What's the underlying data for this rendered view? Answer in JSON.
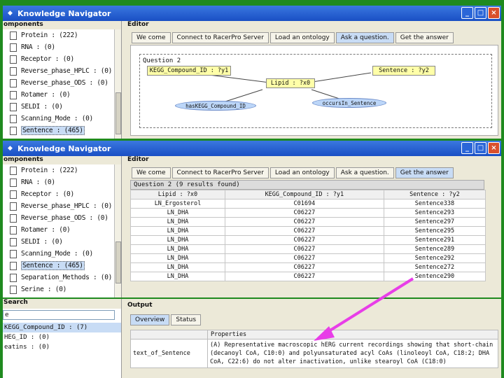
{
  "window1": {
    "title": "Knowledge Navigator",
    "components_header": "omponents",
    "editor_header": "Editor",
    "tree_items": [
      "Protein : (222)",
      "RNA : (0)",
      "Receptor : (0)",
      "Reverse_phase_HPLC : (0)",
      "Reverse_phase_ODS : (0)",
      "Rotamer : (0)",
      "SELDI : (0)",
      "Scanning_Mode : (0)",
      "Sentence : (465)"
    ],
    "selected_item": 8,
    "tabs": [
      "We come",
      "Connect to RacerPro Server",
      "Load an ontology",
      "Ask a question.",
      "Get the answer"
    ],
    "active_tab": 3,
    "question_title": "Question 2",
    "nodes": {
      "kegg": "KEGG_Compound_ID : ?y1",
      "lipid": "Lipid : ?x0",
      "sentence": "Sentence : ?y2",
      "has_kegg": "hasKEGG_Compound_ID",
      "occurs": "occursIn_Sentence"
    }
  },
  "window2": {
    "title": "Knowledge Navigator",
    "components_header": "omponents",
    "editor_header": "Editor",
    "tree_items": [
      "Protein : (222)",
      "RNA : (0)",
      "Receptor : (0)",
      "Reverse_phase_HPLC : (0)",
      "Reverse_phase_ODS : (0)",
      "Rotamer : (0)",
      "SELDI : (0)",
      "Scanning_Mode : (0)",
      "Sentence : (465)",
      "Separation_Methods : (0)",
      "Serine : (0)"
    ],
    "selected_item": 8,
    "tabs": [
      "We come",
      "Connect to RacerPro Server",
      "Load an ontology",
      "Ask a question.",
      "Get the answer"
    ],
    "active_tab": 4,
    "results_header": "Question 2 (9 results found)",
    "columns": [
      "Lipid : ?x0",
      "KEGG_Compound_ID : ?y1",
      "Sentence : ?y2"
    ],
    "rows": [
      [
        "LN_Ergosterol",
        "C01694",
        "Sentence338"
      ],
      [
        "LN_DHA",
        "C06227",
        "Sentence293"
      ],
      [
        "LN_DHA",
        "C06227",
        "Sentence297"
      ],
      [
        "LN_DHA",
        "C06227",
        "Sentence295"
      ],
      [
        "LN_DHA",
        "C06227",
        "Sentence291"
      ],
      [
        "LN_DHA",
        "C06227",
        "Sentence289"
      ],
      [
        "LN_DHA",
        "C06227",
        "Sentence292"
      ],
      [
        "LN_DHA",
        "C06227",
        "Sentence272"
      ],
      [
        "LN_DHA",
        "C06227",
        "Sentence290"
      ]
    ]
  },
  "bottom": {
    "search_header": "Search",
    "search_value": "e",
    "search_items": [
      "KEGG_Compound_ID : (7)",
      "HEG_ID : (0)",
      "eatins : (0)"
    ],
    "output_header": "Output",
    "output_tabs": [
      "Overview",
      "Status"
    ],
    "properties_header": "Properties",
    "property_key": "text_of_Sentence",
    "property_value": "(A) Representative macroscopic hERG current recordings showing that short-chain (decanoyl CoA, C10:0) and polyunsaturated acyl CoAs (linoleoyl CoA, C18:2; DHA CoA, C22:6) do not alter inactivation, unlike stearoyl CoA (C18:0)"
  },
  "colors": {
    "background": "#1f8a1f",
    "arrow": "#e83ee8",
    "titlebar": "#2a5fd0",
    "selection": "#c8dcf5"
  }
}
